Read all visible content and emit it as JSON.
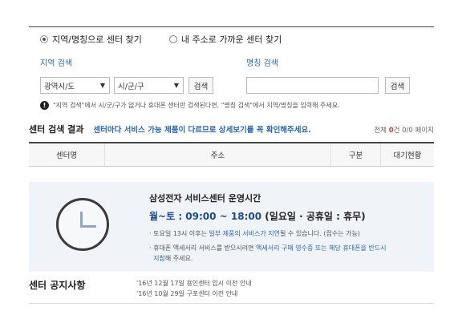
{
  "search_mode": {
    "options": [
      {
        "label": "지역/명칭으로 센터 찾기",
        "selected": true
      },
      {
        "label": "내 주소로 가까운 센터 찾기",
        "selected": false
      }
    ]
  },
  "region_search": {
    "label": "지역 검색",
    "province_value": "광역시/도",
    "city_value": "시/군/구",
    "button_label": "검색"
  },
  "name_search": {
    "label": "명칭 검색",
    "input_value": "",
    "button_label": "검색"
  },
  "notice_text": "\"지역 검색\"에서 시/군/구가 없거나 휴대폰 센터만 검색된다면, \"명칭 검색\"에서 지역/명칭을 입력해 주세요.",
  "result": {
    "title": "센터 검색 결과",
    "description": "센터마다 서비스 가능 제품이 다르므로 상세보기를 꼭 확인해주세요.",
    "count_prefix": "전체",
    "count_value": "0",
    "count_suffix": "건 0/0 페이지"
  },
  "table": {
    "columns": [
      "센터명",
      "주소",
      "구분",
      "대기현황"
    ]
  },
  "hours": {
    "title": "삼성전자 서비스센터 운영시간",
    "time": "월~토 : 09:00 ~ 18:00",
    "holiday": "(일요일 · 공휴일 : 휴무)",
    "note1_a": "토요일 13시 이후는 ",
    "note1_b": "일부 제품의 서비스가 지연",
    "note1_c": "될 수 있습니다. (접수는 가능)",
    "note2_a": "휴대폰 액세서리 서비스를 받으시려면 ",
    "note2_b": "액세서리 구매 영수증 또는 해당 휴대폰을 반드시",
    "note2_c": "지참",
    "note2_d": "해 주세요."
  },
  "center_notice": {
    "title": "센터 공지사항",
    "items": [
      "'16년 12월 17일 용인센터 임시 이전 안내",
      "'16년 10월 29일 구포센터 이전 안내"
    ]
  }
}
